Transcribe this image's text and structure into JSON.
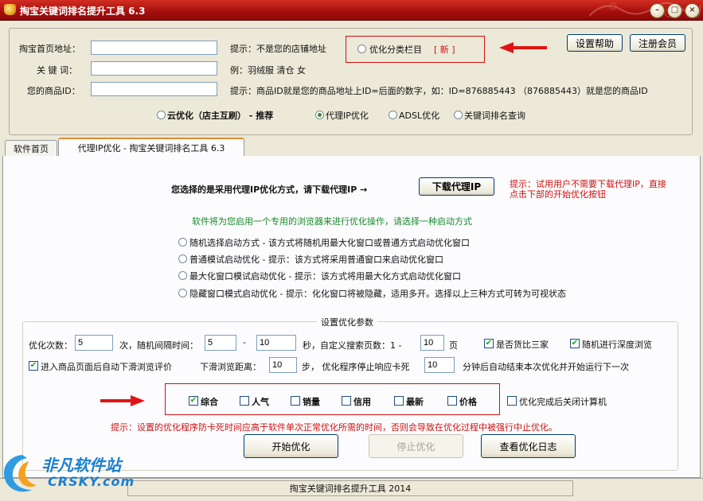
{
  "window": {
    "title": "掏宝关键词排名提升工具  6.3"
  },
  "top": {
    "shop_url_label": "掏宝首页地址：",
    "shop_url_value": "",
    "shop_url_hint": "提示：不是您的店铺地址",
    "keyword_label": "关 键 词：",
    "keyword_value": "",
    "keyword_hint": "例：羽绒服 清仓 女",
    "product_id_label": "您的商品ID：",
    "product_id_value": "",
    "product_id_hint": "提示：商品ID就是您的商品地址上ID=后面的数字，如：ID=876885443 （876885443）就是您的商品ID",
    "category_opt_label": "优化分类栏目",
    "new_badge": "[ 新 ]",
    "help_button": "设置帮助",
    "register_button": "注册会员",
    "modes": [
      {
        "label": "云优化（店主互刷） - 推荐",
        "selected": false
      },
      {
        "label": "代理IP优化",
        "selected": true
      },
      {
        "label": "ADSL优化",
        "selected": false
      },
      {
        "label": "关键词排名查询",
        "selected": false
      }
    ]
  },
  "tabs": [
    {
      "label": "软件首页",
      "active": false
    },
    {
      "label": "代理IP优化 - 掏宝关键词排名工具 6.3",
      "active": true
    }
  ],
  "proxy": {
    "prompt": "您选择的是采用代理IP优化方式，请下载代理IP →",
    "download_button": "下载代理IP",
    "trial_hint_line1": "提示：试用用户不需要下载代理IP，直接",
    "trial_hint_line2": "点击下部的开始优化按钮",
    "browser_notice": "软件将为您启用一个专用的浏览器来进行优化操作，请选择一种启动方式",
    "start_modes": [
      {
        "label": "随机选择启动方式 - 该方式将随机用最大化窗口或普通方式启动优化窗口",
        "selected": false
      },
      {
        "label": "普通模试启动优化 - 提示：该方式将采用普通窗口来启动优化窗口",
        "selected": false
      },
      {
        "label": "最大化窗口模试启动优化 - 提示：该方式将用最大化方式启动优化窗口",
        "selected": false
      },
      {
        "label": "隐藏窗口模式启动优化 - 提示：化化窗口将被隐藏，适用多开。选择以上三种方式可转为可视状态",
        "selected": false
      }
    ]
  },
  "params": {
    "group_title": "设置优化参数",
    "count_label": "优化次数：",
    "count_value": "5",
    "interval_label": "次，随机间隔时间：",
    "interval_min": "5",
    "dash": "-",
    "interval_max": "10",
    "pages_label": "秒，自定义搜索页数：1 -",
    "pages_value": "10",
    "pages_unit": "页",
    "compare_three_label": "是否货比三家",
    "compare_three_checked": true,
    "deep_browse_label": "随机进行深度浏览",
    "deep_browse_checked": true,
    "scroll_review_label": "进入商品页面后自动下滑浏览评价",
    "scroll_review_checked": true,
    "scroll_distance_label": "下滑浏览距离：",
    "scroll_distance_value": "10",
    "stop_label": "步，  优化程序停止响应卡死",
    "stop_value": "10",
    "stop_suffix": "分钟后自动结束本次优化并开始运行下一次",
    "sort_options": [
      {
        "label": "综合",
        "checked": true
      },
      {
        "label": "人气",
        "checked": false
      },
      {
        "label": "销量",
        "checked": false
      },
      {
        "label": "信用",
        "checked": false
      },
      {
        "label": "最新",
        "checked": false
      },
      {
        "label": "价格",
        "checked": false
      }
    ],
    "shutdown_label": "优化完成后关闭计算机",
    "shutdown_checked": false,
    "warning": "提示：设置的优化程序防卡死时间应高于软件单次正常优化所需的时间，否则会导致在优化过程中被强行中止优化。"
  },
  "actions": {
    "start": "开始优化",
    "stop": "停止优化",
    "log": "查看优化日志"
  },
  "status": {
    "text": "掏宝关键词排名提升工具 2014"
  },
  "watermark": {
    "brand": "非凡软件站",
    "domain": "CRSKY.com"
  },
  "colors": {
    "title_bar": "#b0140f",
    "accent_red": "#d01010",
    "notice_green": "#138a2a"
  }
}
